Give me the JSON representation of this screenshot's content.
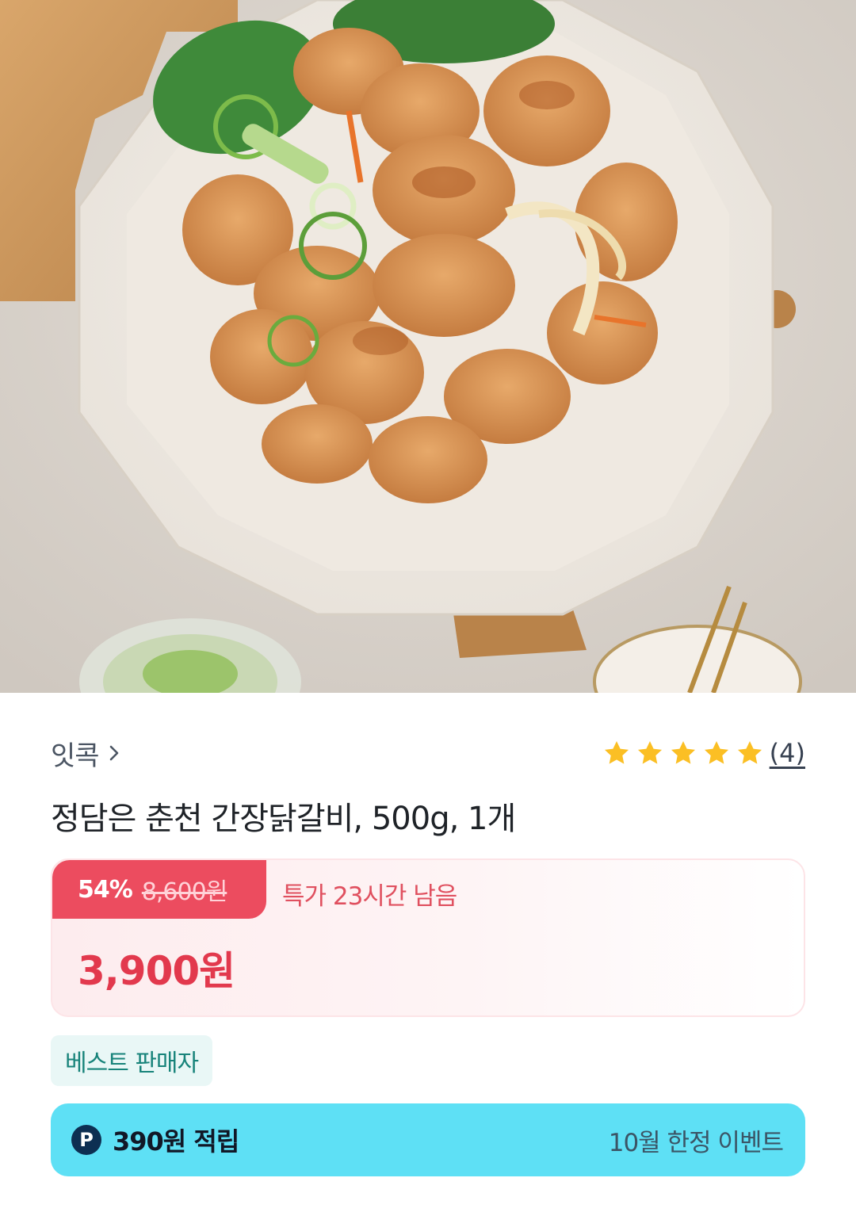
{
  "product_image": {
    "alt": "정담은 춘천 간장닭갈비"
  },
  "seller": {
    "name": "잇콕",
    "chevron_icon": "chevron-right-icon"
  },
  "rating": {
    "stars": 5,
    "count": "(4)",
    "star_color": "#fbbf24"
  },
  "product": {
    "title": "정담은 춘천 간장닭갈비, 500g, 1개"
  },
  "price": {
    "discount_rate": "54%",
    "original_price": "8,600원",
    "timer_text": "특가 23시간 남음",
    "sale_price": "3,900원",
    "accent_color": "#ec4c5f"
  },
  "badges": {
    "best_seller": "베스트 판매자"
  },
  "points": {
    "icon_letter": "P",
    "label": "390원 적립",
    "event": "10월 한정 이벤트",
    "bar_color": "#5ee0f5"
  }
}
